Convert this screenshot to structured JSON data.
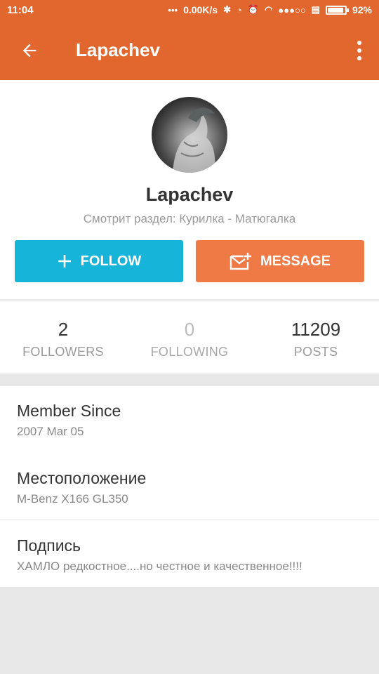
{
  "status_bar": {
    "time": "11:04",
    "network_speed": "0.00K/s",
    "signal": "●●●○○",
    "battery": "92%"
  },
  "app_bar": {
    "title": "Lapachev",
    "back_icon": "arrow-left-icon",
    "more_icon": "more-vertical-icon"
  },
  "profile": {
    "name": "Lapachev",
    "viewing_text": "Смотрит раздел: Курилка - Матюгалка",
    "follow_label": "FOLLOW",
    "message_label": "MESSAGE"
  },
  "stats": [
    {
      "value": "2",
      "label": "FOLLOWERS"
    },
    {
      "value": "0",
      "label": "FOLLOWING"
    },
    {
      "value": "11209",
      "label": "POSTS"
    }
  ],
  "info": [
    {
      "title": "Member Since",
      "value": "2007 Mar 05"
    },
    {
      "title": "Местоположение",
      "value": "M-Benz X166 GL350"
    },
    {
      "title": "Подпись",
      "value": "ХАМЛО редкостное....но честное и качественное!!!!"
    }
  ],
  "colors": {
    "app_bar": "#e2672f",
    "follow": "#16b4d8",
    "message": "#ef7a45"
  }
}
